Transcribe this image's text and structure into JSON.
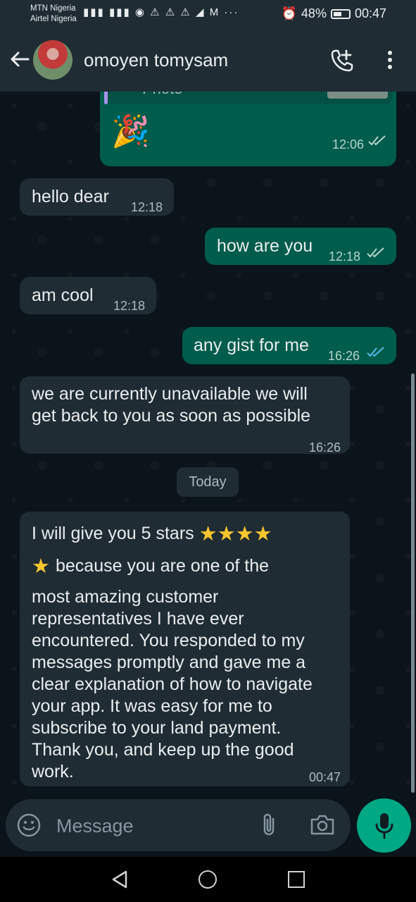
{
  "status_bar": {
    "carrier_1": "MTN Nigeria",
    "carrier_2": "Airtel Nigeria",
    "notification_icons": [
      "signal-icon",
      "signal-icon",
      "hotspot-icon",
      "warning-icon",
      "warning-icon",
      "warning-icon",
      "telegram-icon",
      "gmail-icon",
      "more-icon"
    ],
    "battery": "48%",
    "time": "00:47"
  },
  "header": {
    "contact_name": "omoyen tomysam"
  },
  "messages": [
    {
      "type": "out",
      "text_partial": "Photo",
      "emoji": "🎉",
      "time": "12:06",
      "status": "delivered"
    },
    {
      "type": "in",
      "text": "hello dear",
      "time": "12:18"
    },
    {
      "type": "out",
      "text": "how are you",
      "time": "12:18",
      "status": "delivered"
    },
    {
      "type": "in",
      "text": "am cool",
      "time": "12:18"
    },
    {
      "type": "out",
      "text": "any gist for me",
      "time": "16:26",
      "status": "read"
    },
    {
      "type": "in",
      "line1": "we are currently unavailable we will",
      "line2": "get back to you as soon as possible",
      "time": "16:26"
    },
    {
      "type": "in",
      "line1": "I will give you 5 stars",
      "line2": "because you are one of the",
      "rest": [
        "most amazing customer",
        "representatives I have ever",
        "encountered. You responded to my",
        "messages promptly and gave me a",
        "clear explanation of how to navigate",
        "your app. It was easy for me to",
        "subscribe to your land payment.",
        "Thank you, and keep up the good",
        "work."
      ],
      "time": "00:47"
    }
  ],
  "date_separator": "Today",
  "composer": {
    "placeholder": "Message"
  },
  "colors": {
    "incoming": "#1f2c34",
    "outgoing": "#005c4b",
    "accent": "#00a884",
    "read_tick": "#53bdeb"
  }
}
